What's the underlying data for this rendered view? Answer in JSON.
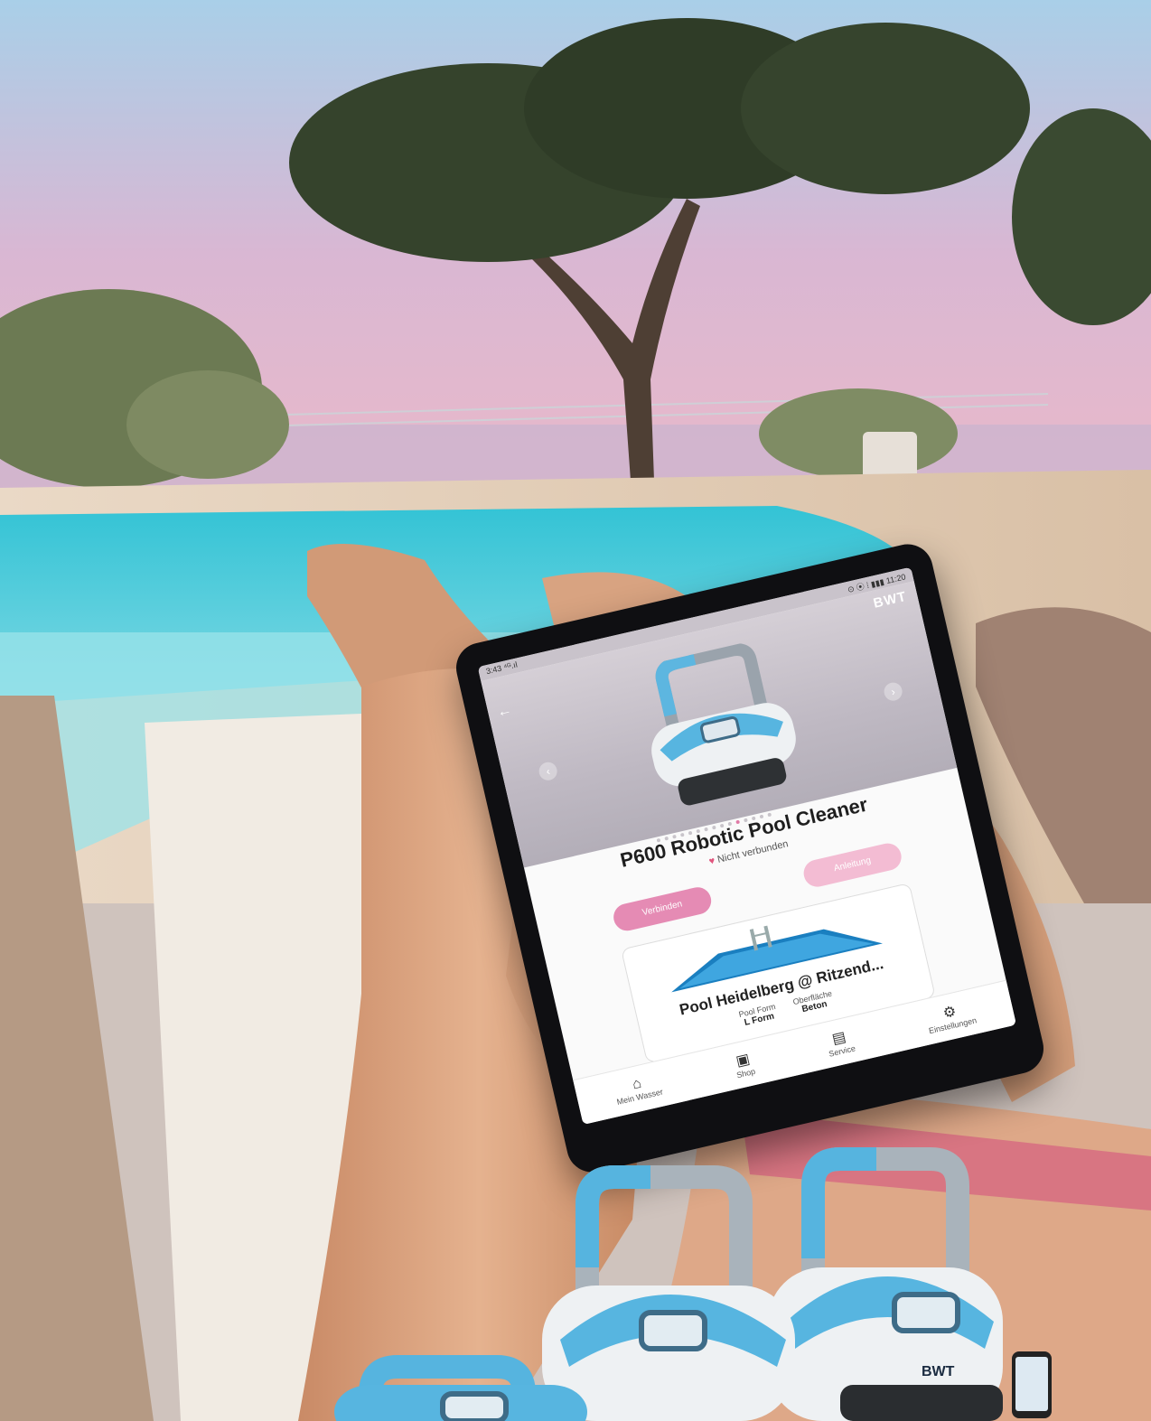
{
  "scene": {
    "description_colors": {
      "sky_top": "#9ec7e6",
      "sky_horizon": "#e8b8cc",
      "pool_water": "#2fc5d6",
      "deck": "#e6d7c5",
      "lounger": "#f2ece4",
      "skin": "#d9a07f",
      "bikini": "#d9737f"
    }
  },
  "tablet": {
    "status_left": "3:43 ⁴ᴳ.ıl",
    "status_right": "⊙ ⦿ ⁞ ▮▮▮ 11:20",
    "brand": "BWT",
    "product_title": "P600 Robotic Pool Cleaner",
    "connection_status": "Nicht verbunden",
    "connect_button": "Verbinden",
    "secondary_button": "Anleitung",
    "pool": {
      "name": "Pool Heidelberg @ Ritzend...",
      "form_label": "Pool Form",
      "form_value": "L Form",
      "surface_label": "Oberfläche",
      "surface_value": "Beton"
    },
    "nav": [
      {
        "label": "Mein Wasser",
        "icon": "home-icon"
      },
      {
        "label": "Shop",
        "icon": "shopping-bag-icon"
      },
      {
        "label": "Service",
        "icon": "chat-icon"
      },
      {
        "label": "Einstellungen",
        "icon": "gear-icon"
      }
    ]
  },
  "robots": {
    "logo": "BWT",
    "accent": "#57b5e0"
  }
}
